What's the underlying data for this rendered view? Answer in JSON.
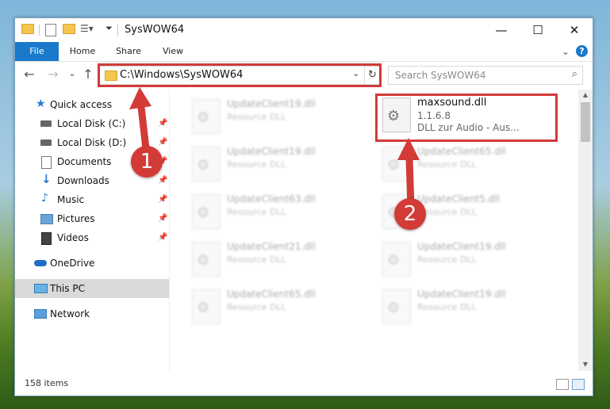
{
  "window": {
    "title": "SysWOW64",
    "minimize": "—",
    "maximize": "☐",
    "close": "✕"
  },
  "ribbon": {
    "tabs": [
      "File",
      "Home",
      "Share",
      "View"
    ],
    "expand": "⌄",
    "help": "?"
  },
  "nav": {
    "back": "←",
    "forward": "→",
    "recent": "⌄",
    "up": "↑",
    "address": "C:\\Windows\\SysWOW64",
    "address_dropdown": "⌄",
    "refresh": "↻",
    "search_placeholder": "Search SysWOW64",
    "search_icon": "⌕"
  },
  "sidebar": {
    "items": [
      {
        "label": "Quick access",
        "icon": "star-icon",
        "pinned": false
      },
      {
        "label": "Local Disk (C:)",
        "icon": "drive-icon",
        "pinned": true
      },
      {
        "label": "Local Disk (D:)",
        "icon": "drive-icon",
        "pinned": true
      },
      {
        "label": "Documents",
        "icon": "documents-icon",
        "pinned": true
      },
      {
        "label": "Downloads",
        "icon": "downloads-icon",
        "pinned": true
      },
      {
        "label": "Music",
        "icon": "music-icon",
        "pinned": true
      },
      {
        "label": "Pictures",
        "icon": "pictures-icon",
        "pinned": true
      },
      {
        "label": "Videos",
        "icon": "videos-icon",
        "pinned": true
      },
      {
        "label": "OneDrive",
        "icon": "onedrive-icon",
        "pinned": false
      },
      {
        "label": "This PC",
        "icon": "computer-icon",
        "pinned": false
      },
      {
        "label": "Network",
        "icon": "network-icon",
        "pinned": false
      }
    ],
    "pin_glyph": "📌"
  },
  "files": [
    {
      "name": "UpdateClient19.dll",
      "desc": "Resource DLL"
    },
    {
      "name": "maxsound.dll",
      "version": "1.1.6.8",
      "desc": "DLL zur Audio - Aus..."
    },
    {
      "name": "UpdateClient19.dll",
      "desc": "Resource DLL"
    },
    {
      "name": "UpdateClient65.dll",
      "desc": "Resource DLL"
    },
    {
      "name": "UpdateClient63.dll",
      "desc": "Resource DLL"
    },
    {
      "name": "UpdateClient5.dll",
      "desc": "Resource DLL"
    },
    {
      "name": "UpdateClient21.dll",
      "desc": "Resource DLL"
    },
    {
      "name": "UpdateClient19.dll",
      "desc": "Resource DLL"
    },
    {
      "name": "UpdateClient65.dll",
      "desc": "Resource DLL"
    },
    {
      "name": "UpdateClient19.dll",
      "desc": "Resource DLL"
    }
  ],
  "status": {
    "item_count": "158 items"
  },
  "annotations": {
    "step1": "1",
    "step2": "2",
    "color": "#d33b36"
  }
}
